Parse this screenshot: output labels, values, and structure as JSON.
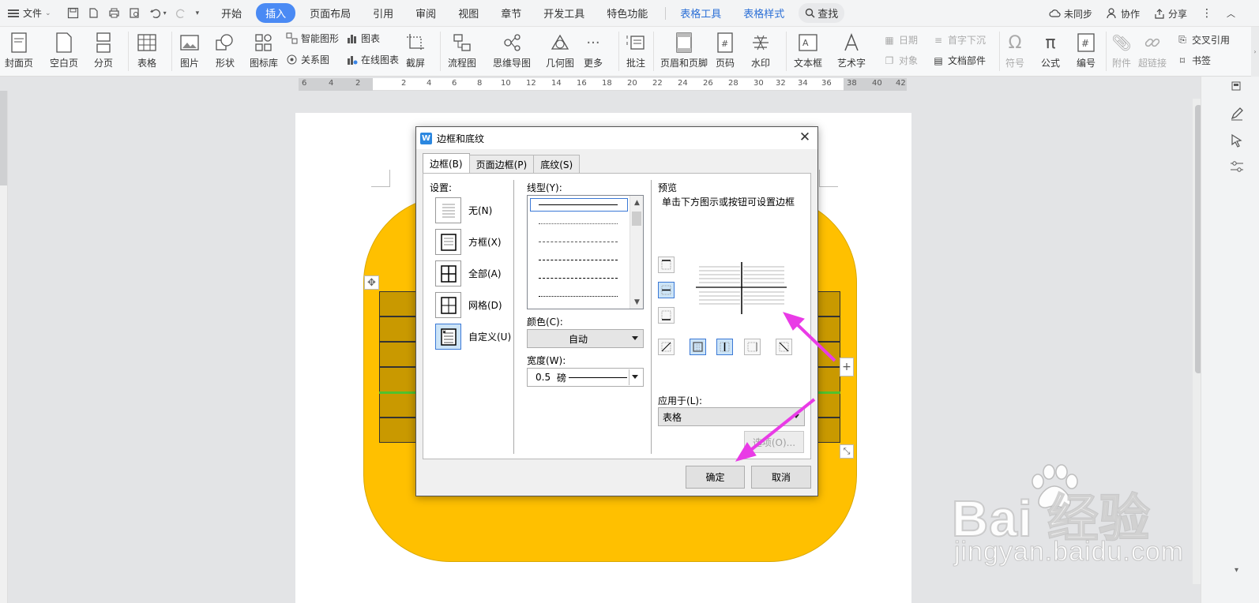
{
  "menubar": {
    "file_label": "文件",
    "tabs": [
      {
        "label": "开始"
      },
      {
        "label": "插入"
      },
      {
        "label": "页面布局"
      },
      {
        "label": "引用"
      },
      {
        "label": "审阅"
      },
      {
        "label": "视图"
      },
      {
        "label": "章节"
      },
      {
        "label": "开发工具"
      },
      {
        "label": "特色功能"
      }
    ],
    "context_tabs": [
      {
        "label": "表格工具"
      },
      {
        "label": "表格样式"
      }
    ],
    "search_label": "查找",
    "right": {
      "sync": "未同步",
      "collab": "协作",
      "share": "分享"
    }
  },
  "ribbon": {
    "cover": "封面页",
    "blank": "空白页",
    "pagebreak": "分页",
    "table": "表格",
    "picture": "图片",
    "shape": "形状",
    "iconlib": "图标库",
    "smartart": "智能图形",
    "chart": "图表",
    "relation": "关系图",
    "onlinechart": "在线图表",
    "screenshot": "截屏",
    "flowchart": "流程图",
    "mindmap": "思维导图",
    "geometry": "几何图",
    "more": "更多",
    "comment": "批注",
    "headerfooter": "页眉和页脚",
    "pagenum": "页码",
    "watermark": "水印",
    "textbox": "文本框",
    "wordart": "艺术字",
    "date": "日期",
    "dropcap": "首字下沉",
    "object": "对象",
    "docparts": "文档部件",
    "symbol": "符号",
    "formula": "公式",
    "numbering": "编号",
    "attachment": "附件",
    "hyperlink": "超链接",
    "crossref": "交叉引用",
    "bookmark": "书签"
  },
  "ruler": {
    "labels": [
      "6",
      "4",
      "2",
      "2",
      "4",
      "6",
      "8",
      "10",
      "12",
      "14",
      "16",
      "18",
      "20",
      "22",
      "24",
      "26",
      "28",
      "30",
      "32",
      "34",
      "36",
      "38",
      "40",
      "42"
    ]
  },
  "dialog": {
    "title": "边框和底纹",
    "close": "✕",
    "tabs": [
      {
        "label": "边框(B)"
      },
      {
        "label": "页面边框(P)"
      },
      {
        "label": "底纹(S)"
      }
    ],
    "settings_label": "设置:",
    "settings": [
      {
        "label": "无(N)"
      },
      {
        "label": "方框(X)"
      },
      {
        "label": "全部(A)"
      },
      {
        "label": "网格(D)"
      },
      {
        "label": "自定义(U)"
      }
    ],
    "line_style_label": "线型(Y):",
    "color_label": "颜色(C):",
    "color_value": "自动",
    "width_label": "宽度(W):",
    "width_value": "0.5",
    "width_unit": "磅",
    "preview_label": "预览",
    "preview_hint": "单击下方图示或按钮可设置边框",
    "apply_label": "应用于(L):",
    "apply_value": "表格",
    "options_button": "选项(O)...",
    "ok_button": "确定",
    "cancel_button": "取消"
  },
  "watermark": {
    "main": "Bai  经验",
    "sub": "jingyan.baidu.com"
  },
  "colors": {
    "accent": "#4a8af4",
    "shape_fill": "#ffc000",
    "arrow": "#e93be6",
    "table_fill": "#c99900",
    "green_line": "#4fc22d"
  }
}
